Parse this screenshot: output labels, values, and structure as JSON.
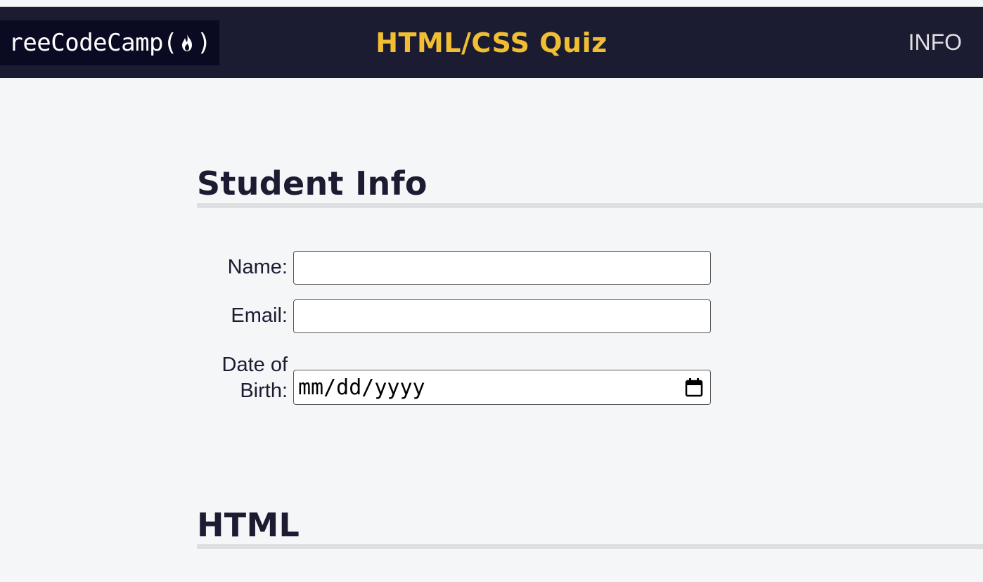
{
  "header": {
    "logo_text": "reeCodeCamp",
    "logo_open_paren": "(",
    "logo_close_paren": ")",
    "title": "HTML/CSS Quiz",
    "nav_info": "INFO"
  },
  "colors": {
    "header_bg": "#1b1b32",
    "logo_bg": "#0a0a23",
    "title_accent": "#f1be32",
    "page_bg": "#f5f6f7",
    "rule": "#dfdfe2"
  },
  "student_info": {
    "heading": "Student Info",
    "name_label": "Name:",
    "email_label": "Email:",
    "dob_label_line1": "Date of",
    "dob_label_line2": "Birth:",
    "name_value": "",
    "email_value": "",
    "dob_placeholder": "mm/dd/yyyy"
  },
  "html_section": {
    "heading": "HTML"
  },
  "icons": {
    "logo_icon": "flame-icon",
    "date_picker_icon": "calendar-icon"
  }
}
